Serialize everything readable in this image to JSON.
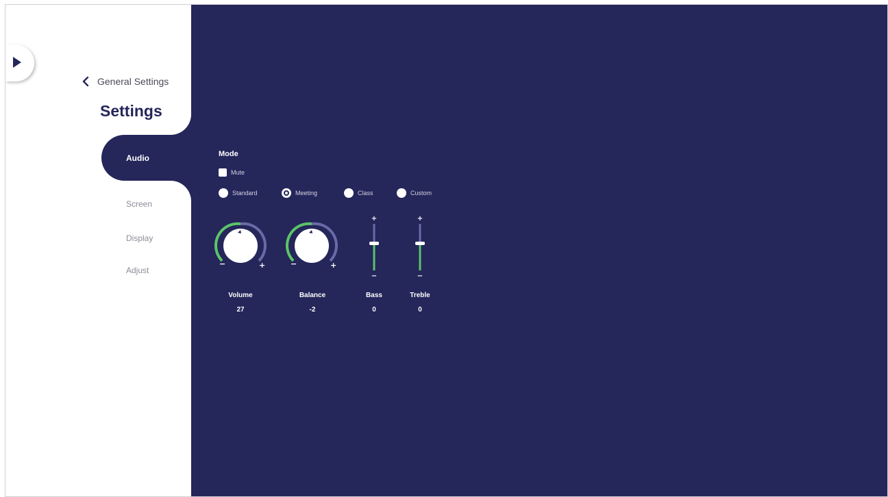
{
  "sidebar": {
    "back_label": "General Settings",
    "title": "Settings",
    "nav": [
      {
        "label": "Audio",
        "active": true
      },
      {
        "label": "Screen"
      },
      {
        "label": "Display"
      },
      {
        "label": "Adjust"
      }
    ]
  },
  "audio": {
    "mode_label": "Mode",
    "mute_label": "Mute",
    "mute_checked": false,
    "modes": [
      {
        "label": "Standard",
        "selected": false
      },
      {
        "label": "Meeting",
        "selected": true
      },
      {
        "label": "Class",
        "selected": false
      },
      {
        "label": "Custom",
        "selected": false
      }
    ],
    "volume": {
      "label": "Volume",
      "value": "27",
      "minus": "−",
      "plus": "+"
    },
    "balance": {
      "label": "Balance",
      "value": "-2",
      "minus": "−",
      "plus": "+"
    },
    "bass": {
      "label": "Bass",
      "value": "0",
      "plus": "+",
      "minus": "−"
    },
    "treble": {
      "label": "Treble",
      "value": "0",
      "plus": "+",
      "minus": "−"
    }
  },
  "colors": {
    "panel": "#25265a",
    "accent_green": "#5bc468",
    "track": "#6a6aa8",
    "white": "#ffffff"
  },
  "icons": {
    "expand": "play-triangle",
    "back": "chevron-left"
  }
}
